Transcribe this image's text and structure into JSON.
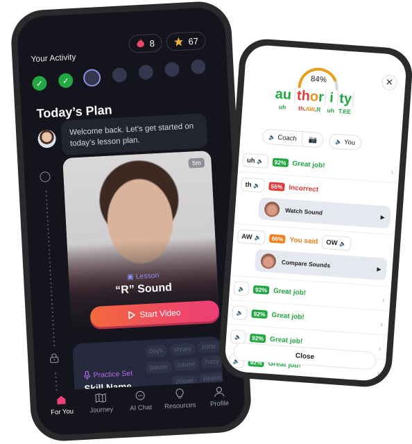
{
  "activity": {
    "label": "Your Activity",
    "streak_count": "8",
    "star_count": "67",
    "streak_icon": "flame-icon",
    "star_icon": "star-icon",
    "days": [
      {
        "state": "done"
      },
      {
        "state": "done"
      },
      {
        "state": "current"
      },
      {
        "state": "upcoming"
      },
      {
        "state": "upcoming"
      },
      {
        "state": "upcoming"
      },
      {
        "state": "upcoming"
      }
    ]
  },
  "plan": {
    "title": "Today’s Plan",
    "welcome_message": "Welcome back. Let’s get started on today’s lesson plan."
  },
  "lesson": {
    "duration": "5m",
    "tag": "Lesson",
    "title": "“R” Sound",
    "cta": "Start Video"
  },
  "practice": {
    "tag": "Practice Set",
    "skill_name": "Skill Name",
    "words": [
      "days",
      "shoes",
      "zone",
      "pause",
      "cause",
      "hazy",
      "zipper",
      "desert"
    ]
  },
  "tabbar": {
    "items": [
      {
        "label": "For You",
        "icon": "home-icon",
        "active": true
      },
      {
        "label": "Journey",
        "icon": "map-icon",
        "active": false
      },
      {
        "label": "AI Chat",
        "icon": "chat-icon",
        "active": false
      },
      {
        "label": "Resources",
        "icon": "lightbulb-icon",
        "active": false
      },
      {
        "label": "Profile",
        "icon": "user-icon",
        "active": false
      }
    ]
  },
  "colors": {
    "accent_pink": "#ee3f78",
    "accent_orange": "#f26a3c",
    "success_green": "#22a843",
    "error_red": "#e23a3a",
    "warning_orange": "#f07c1e",
    "lesson_purple": "#8e8ff0",
    "practice_purple": "#b56ae8"
  },
  "feedback": {
    "score": "84%",
    "score_value": 0.84,
    "word_segments": [
      {
        "text": "au",
        "phonetic": "uh",
        "color": "green"
      },
      {
        "text": "thor",
        "phonetic": "th.AW.R",
        "color": "mixed"
      },
      {
        "text": "i",
        "phonetic": "uh",
        "color": "green"
      },
      {
        "text": "ty",
        "phonetic": "T.EE",
        "color": "green"
      }
    ],
    "coach_label": "Coach",
    "you_label": "You",
    "rows": [
      {
        "sound": "uh",
        "pct": "92%",
        "verdict": "Great job!",
        "status": "good"
      },
      {
        "sound": "th",
        "pct": "55%",
        "verdict": "Incorrect",
        "status": "bad",
        "media": "Watch Sound"
      },
      {
        "sound": "AW",
        "pct": "66%",
        "verdict": "You said",
        "said": "OW",
        "status": "warn",
        "media": "Compare Sounds"
      },
      {
        "sound": "",
        "pct": "92%",
        "verdict": "Great job!",
        "status": "good"
      },
      {
        "sound": "",
        "pct": "92%",
        "verdict": "Great job!",
        "status": "good"
      },
      {
        "sound": "",
        "pct": "92%",
        "verdict": "Great job!",
        "status": "good"
      },
      {
        "sound": "",
        "pct": "92%",
        "verdict": "Great job!",
        "status": "good"
      }
    ],
    "close_label": "Close"
  }
}
